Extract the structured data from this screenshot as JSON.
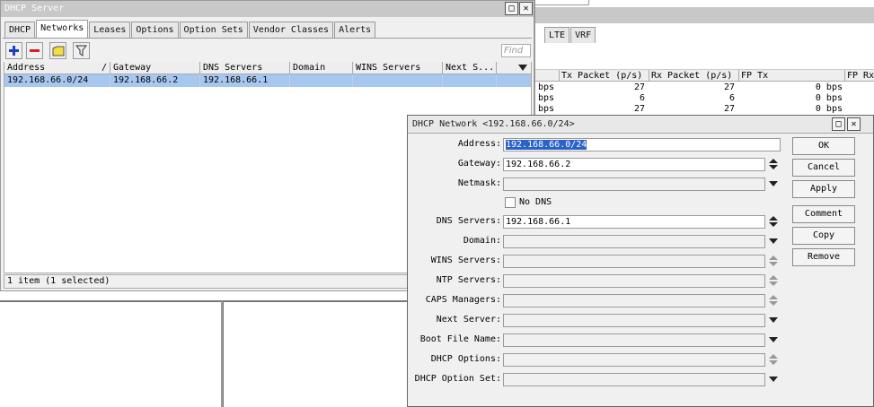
{
  "dhcp_window": {
    "title": "DHCP Server",
    "tabs": [
      "DHCP",
      "Networks",
      "Leases",
      "Options",
      "Option Sets",
      "Vendor Classes",
      "Alerts"
    ],
    "active_tab": "Networks",
    "find_placeholder": "Find",
    "columns": [
      "Address",
      "Gateway",
      "DNS Servers",
      "Domain",
      "WINS Servers",
      "Next S..."
    ],
    "sort_indicator": "/",
    "rows": [
      {
        "address": "192.168.66.0/24",
        "gateway": "192.168.66.2",
        "dns": "192.168.66.1",
        "domain": "",
        "wins": "",
        "next": ""
      }
    ],
    "status": "1 item (1 selected)"
  },
  "bg_window": {
    "tabs": [
      "LTE",
      "VRF"
    ],
    "columns": [
      "Tx Packet (p/s)",
      "Rx Packet (p/s)",
      "FP Tx",
      "FP Rx"
    ],
    "rows": [
      {
        "unit": "bps",
        "tx": "27",
        "rx": "27",
        "fptx": "0 bps"
      },
      {
        "unit": "bps",
        "tx": "6",
        "rx": "6",
        "fptx": "0 bps"
      },
      {
        "unit": "bps",
        "tx": "27",
        "rx": "27",
        "fptx": "0 bps"
      }
    ]
  },
  "dialog": {
    "title": "DHCP Network <192.168.66.0/24>",
    "fields": {
      "address_label": "Address:",
      "address_value": "192.168.66.0/24",
      "gateway_label": "Gateway:",
      "gateway_value": "192.168.66.2",
      "netmask_label": "Netmask:",
      "nodns_label": "No DNS",
      "dns_label": "DNS Servers:",
      "dns_value": "192.168.66.1",
      "domain_label": "Domain:",
      "wins_label": "WINS Servers:",
      "ntp_label": "NTP Servers:",
      "caps_label": "CAPS Managers:",
      "next_label": "Next Server:",
      "boot_label": "Boot File Name:",
      "dhcpopt_label": "DHCP Options:",
      "dhcpoptset_label": "DHCP Option Set:"
    },
    "buttons": {
      "ok": "OK",
      "cancel": "Cancel",
      "apply": "Apply",
      "comment": "Comment",
      "copy": "Copy",
      "remove": "Remove"
    }
  },
  "colors": {
    "selection": "#a6c8f0",
    "field_selected": "#2a62c8",
    "add_icon": "#1e3fc8",
    "remove_icon": "#d0202a",
    "folder_icon": "#f2de3c"
  }
}
